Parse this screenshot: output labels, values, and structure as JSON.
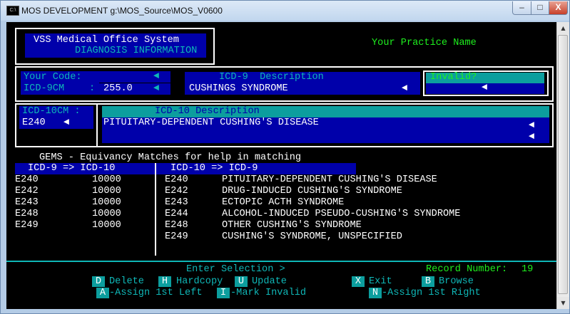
{
  "window": {
    "title": "MOS DEVELOPMENT  g:\\MOS_Source\\MOS_V0600",
    "icon": "console-icon",
    "min": "–",
    "max": "□",
    "close": "X"
  },
  "header": {
    "app_name": "VSS Medical Office System",
    "screen_name": "DIAGNOSIS INFORMATION",
    "practice_name": "Your Practice Name"
  },
  "code_section": {
    "your_code_label": "Your Code:",
    "your_code_value": "",
    "icd9_label": "ICD-9CM",
    "icd9_sep": ":",
    "icd9_value": "255.0",
    "icd9_desc_label": "ICD-9  Description",
    "icd9_desc_value": "CUSHINGS SYNDROME",
    "invalid_label": "Invalid?",
    "invalid_value": ""
  },
  "icd10_section": {
    "label": "ICD-10CM :",
    "code": "E240",
    "desc_label": "ICD-10 Description",
    "desc_lines": [
      "PITUITARY-DEPENDENT CUSHING'S DISEASE",
      "",
      ""
    ]
  },
  "gems": {
    "title": "GEMS - Equivancy Matches for help in matching",
    "left_header": "ICD-9 => ICD-10",
    "right_header": "ICD-10 => ICD-9",
    "left_rows": [
      {
        "code": "E240",
        "flag": "10000"
      },
      {
        "code": "E242",
        "flag": "10000"
      },
      {
        "code": "E243",
        "flag": "10000"
      },
      {
        "code": "E248",
        "flag": "10000"
      },
      {
        "code": "E249",
        "flag": "10000"
      }
    ],
    "right_rows": [
      {
        "code": "E240",
        "desc": "PITUITARY-DEPENDENT CUSHING'S DISEASE"
      },
      {
        "code": "E242",
        "desc": "DRUG-INDUCED CUSHING'S SYNDROME"
      },
      {
        "code": "E243",
        "desc": "ECTOPIC ACTH SYNDROME"
      },
      {
        "code": "E244",
        "desc": "ALCOHOL-INDUCED PSEUDO-CUSHING'S SYNDROME"
      },
      {
        "code": "E248",
        "desc": "OTHER CUSHING'S SYNDROME"
      },
      {
        "code": "E249",
        "desc": "CUSHING'S SYNDROME, UNSPECIFIED"
      }
    ]
  },
  "footer": {
    "prompt": "Enter Selection >",
    "record_label": "Record Number:",
    "record_number": "19",
    "commands": [
      {
        "key": "D",
        "label": "Delete"
      },
      {
        "key": "H",
        "label": "Hardcopy"
      },
      {
        "key": "U",
        "label": "Update"
      },
      {
        "key": "X",
        "label": "Exit"
      },
      {
        "key": "B",
        "label": "Browse"
      },
      {
        "key": "A",
        "label": "-Assign 1st Left"
      },
      {
        "key": "I",
        "label": "-Mark Invalid"
      },
      {
        "key": "N",
        "label": "-Assign 1st Right"
      }
    ]
  },
  "glyphs": {
    "left_arrow": "◄",
    "scroll_up": "▲",
    "scroll_down": "▼"
  }
}
